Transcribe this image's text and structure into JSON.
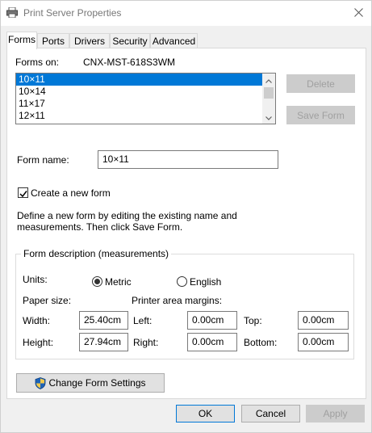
{
  "window": {
    "title": "Print Server Properties"
  },
  "tabs": [
    {
      "label": "Forms"
    },
    {
      "label": "Ports"
    },
    {
      "label": "Drivers"
    },
    {
      "label": "Security"
    },
    {
      "label": "Advanced"
    }
  ],
  "forms": {
    "forms_on_label": "Forms on:",
    "server_name": "CNX-MST-618S3WM",
    "list_items": [
      "10×11",
      "10×14",
      "11×17",
      "12×11"
    ],
    "selected_item": "10×11",
    "delete_label": "Delete",
    "save_form_label": "Save Form",
    "form_name_label": "Form name:",
    "form_name_value": "10×11",
    "create_new_form_label": "Create a new form",
    "create_new_form_checked": true,
    "description_line1": "Define a new form by editing the existing name and",
    "description_line2": "measurements. Then click Save Form."
  },
  "measurements": {
    "group_title": "Form description (measurements)",
    "units_label": "Units:",
    "metric_label": "Metric",
    "english_label": "English",
    "selected_unit": "Metric",
    "paper_size_label": "Paper size:",
    "printer_margins_label": "Printer area margins:",
    "width_label": "Width:",
    "width_value": "25.40cm",
    "height_label": "Height:",
    "height_value": "27.94cm",
    "left_label": "Left:",
    "left_value": "0.00cm",
    "right_label": "Right:",
    "right_value": "0.00cm",
    "top_label": "Top:",
    "top_value": "0.00cm",
    "bottom_label": "Bottom:",
    "bottom_value": "0.00cm"
  },
  "change_settings_label": "Change Form Settings",
  "footer": {
    "ok_label": "OK",
    "cancel_label": "Cancel",
    "apply_label": "Apply"
  },
  "colors": {
    "selection": "#0078d7",
    "shield_blue": "#1e63b6",
    "shield_yellow": "#f2c94c"
  }
}
